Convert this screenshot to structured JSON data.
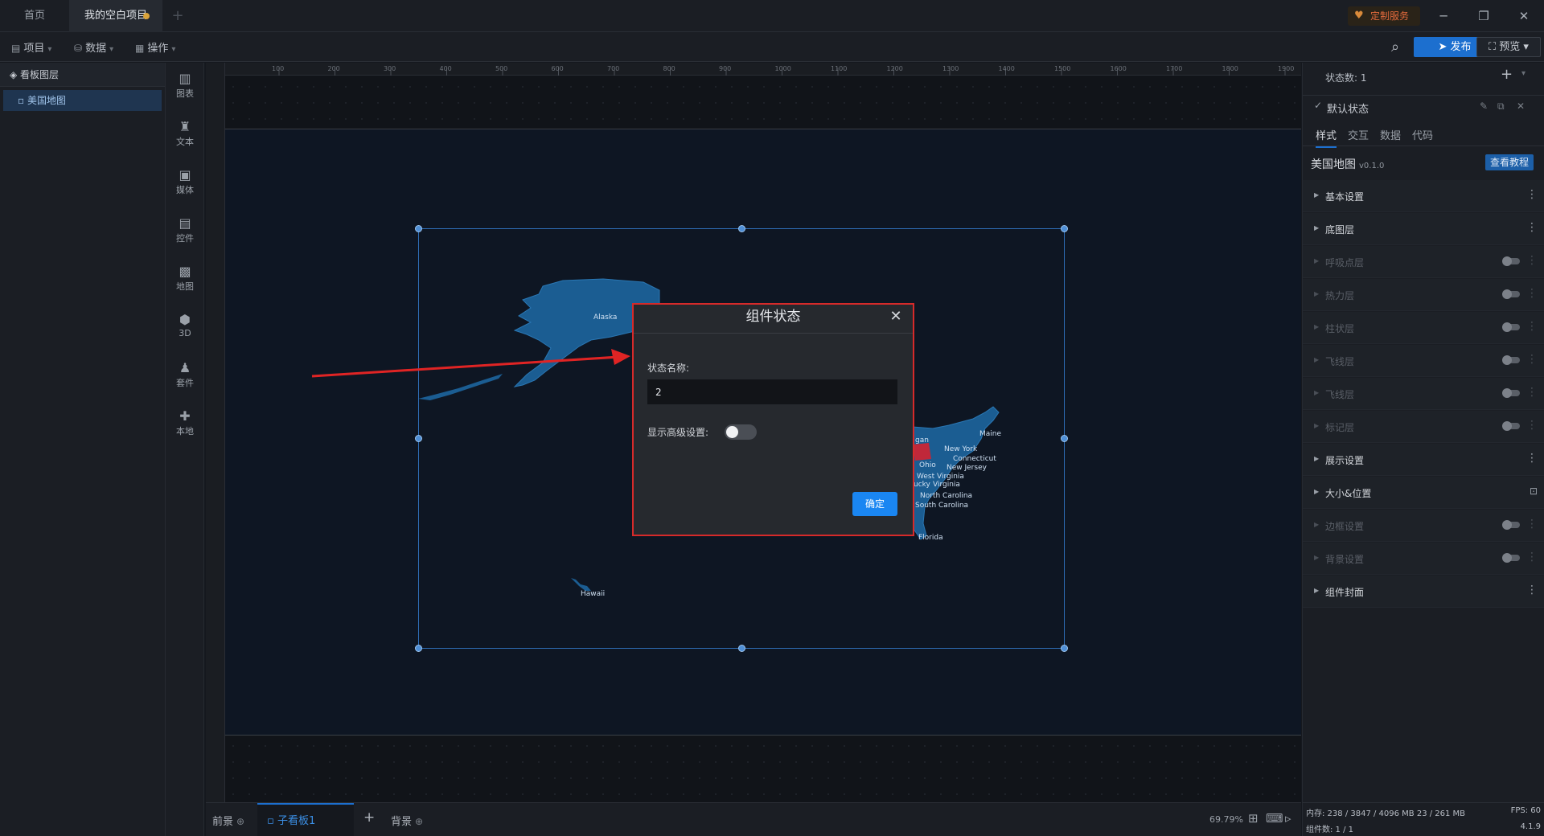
{
  "tabs": {
    "home": "首页",
    "project": "我的空白项目"
  },
  "header": {
    "custom_service": "定制服务"
  },
  "toolbar": {
    "project": "项目",
    "data": "数据",
    "operate": "操作",
    "publish": "发布",
    "preview": "预览"
  },
  "layers": {
    "title": "看板图层",
    "items": [
      {
        "label": "美国地图"
      }
    ]
  },
  "components": [
    "图表",
    "文本",
    "媒体",
    "控件",
    "地图",
    "3D",
    "套件",
    "本地"
  ],
  "ruler": {
    "h_ticks": [
      "100",
      "200",
      "300",
      "400",
      "500",
      "600",
      "700",
      "800",
      "900",
      "1000",
      "1100",
      "1200",
      "1300",
      "1400",
      "1500",
      "1600",
      "1700",
      "1800",
      "1900"
    ]
  },
  "map": {
    "labels": [
      "Alaska",
      "Hawaii",
      "Maine",
      "New York",
      "Connecticut",
      "New Jersey",
      "Ohio",
      "West Virginia",
      "Virginia",
      "North Carolina",
      "South Carolina",
      "Florida",
      "ucky",
      "Ohio",
      "gan"
    ]
  },
  "modal": {
    "title": "组件状态",
    "state_name_label": "状态名称:",
    "state_name_value": "2",
    "advanced_label": "显示高级设置:",
    "advanced_enabled": false,
    "confirm": "确定"
  },
  "bottom": {
    "foreground": "前景",
    "subboard": "子看板1",
    "background": "背景",
    "zoom": "69.79%"
  },
  "right_panel": {
    "state_count": "状态数: 1",
    "default_state": "默认状态",
    "tabs": [
      "样式",
      "交互",
      "数据",
      "代码"
    ],
    "component_name": "美国地图",
    "component_version": "v0.1.0",
    "tutorial": "查看教程",
    "sections": [
      {
        "name": "基本设置",
        "enabled": true,
        "control": "more"
      },
      {
        "name": "底图层",
        "enabled": true,
        "control": "more"
      },
      {
        "name": "呼吸点层",
        "enabled": false,
        "control": "switch"
      },
      {
        "name": "热力层",
        "enabled": false,
        "control": "switch"
      },
      {
        "name": "柱状层",
        "enabled": false,
        "control": "switch"
      },
      {
        "name": "飞线层",
        "enabled": false,
        "control": "switch"
      },
      {
        "name": "飞线层",
        "enabled": false,
        "control": "switch"
      },
      {
        "name": "标记层",
        "enabled": false,
        "control": "switch"
      },
      {
        "name": "展示设置",
        "enabled": true,
        "control": "more"
      },
      {
        "name": "大小&位置",
        "enabled": true,
        "control": "lock"
      },
      {
        "name": "边框设置",
        "enabled": false,
        "control": "switch"
      },
      {
        "name": "背景设置",
        "enabled": false,
        "control": "switch"
      },
      {
        "name": "组件封面",
        "enabled": true,
        "control": "more"
      }
    ]
  },
  "status": {
    "memory": "内存: 238 / 3847 / 4096 MB 23 / 261 MB",
    "fps": "FPS: 60",
    "component_count": "组件数: 1 / 1",
    "version": "4.1.9"
  },
  "colors": {
    "accent": "#1c6fcf",
    "highlight_border": "#d62a2a",
    "confirm": "#1a86f2",
    "state_blue": "#1b5d92",
    "state_red": "#c0283a"
  }
}
